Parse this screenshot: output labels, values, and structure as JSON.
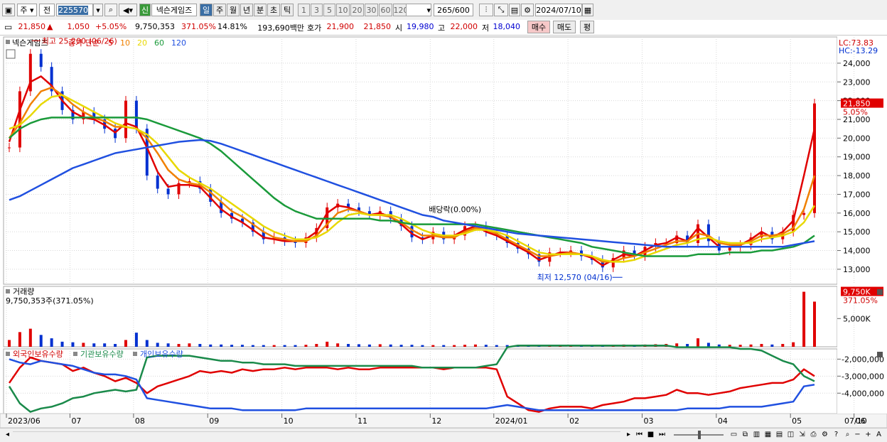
{
  "toolbar": {
    "market_type": "주",
    "market_scope": "전",
    "code": "225570",
    "new_badge": "신",
    "stock_name": "넥슨게임즈",
    "periods": [
      "일",
      "주",
      "월",
      "년",
      "분",
      "초",
      "틱"
    ],
    "active_period": "일",
    "intervals": [
      "1",
      "3",
      "5",
      "10",
      "20",
      "30",
      "60",
      "120"
    ],
    "count_display": "265/600",
    "date": "2024/07/10"
  },
  "quote": {
    "price": "21,850",
    "arrow": "▲",
    "change": "1,050",
    "change_pct": "+5.05%",
    "volume": "9,750,353",
    "volume_pct": "371.05%",
    "turnover": "14.81%",
    "amount": "193,690백만",
    "bid_label": "호가",
    "bid1": "21,900",
    "bid2": "21,850",
    "open_label": "시",
    "open": "19,980",
    "high_label": "고",
    "high": "22,000",
    "low_label": "저",
    "low": "18,040",
    "buy_button": "매수",
    "sell_button": "매도",
    "extra_button": "평"
  },
  "chart_data": [
    {
      "type": "line",
      "title": "넥슨게임즈",
      "legend": {
        "price": "종가 단순",
        "ma_labels": [
          "5",
          "10",
          "20",
          "60",
          "120"
        ],
        "ma_colors": [
          "#e00000",
          "#f08000",
          "#e8d800",
          "#1a9a3a",
          "#2050e0"
        ]
      },
      "yaxis": {
        "ticks": [
          "24,000",
          "23,000",
          "22,000",
          "21,000",
          "20,000",
          "19,000",
          "18,000",
          "17,000",
          "16,000",
          "15,000",
          "14,000",
          "13,000"
        ],
        "ylim": [
          12200,
          25400
        ]
      },
      "xaxis": {
        "ticks": [
          "2023/06",
          "07",
          "08",
          "09",
          "10",
          "11",
          "12",
          "2024/01",
          "02",
          "03",
          "04",
          "05",
          "06",
          "07",
          "07/10"
        ]
      },
      "lc_label": "LC:73.83",
      "hc_label": "HC:-13.29",
      "current_price_label": "21,850",
      "current_change_label": "5.05%",
      "annotations": {
        "high": "최고 25,200 (06/26)",
        "low": "최저 12,570 (04/16)",
        "dividend": "배당락(0.00%)"
      },
      "series": [
        {
          "name": "종가",
          "color": "#000000",
          "values": [
            19500,
            22500,
            24500,
            23800,
            22500,
            21500,
            21000,
            21400,
            21000,
            20500,
            20000,
            22000,
            20500,
            18000,
            17300,
            17000,
            17600,
            17700,
            17300,
            16600,
            16000,
            15700,
            15500,
            15000,
            14600,
            14700,
            14500,
            14400,
            14700,
            15200,
            16300,
            16500,
            16300,
            16100,
            15900,
            16100,
            15700,
            15300,
            14700,
            14600,
            15000,
            14600,
            14800,
            15300,
            15300,
            15000,
            14800,
            14400,
            14100,
            13800,
            13400,
            13900,
            13900,
            14000,
            13700,
            13500,
            13100,
            13600,
            14000,
            13700,
            14200,
            14400,
            14400,
            14800,
            14400,
            15400,
            14500,
            14000,
            14200,
            14300,
            14700,
            15000,
            14600,
            15000,
            15900,
            16000,
            21850
          ]
        },
        {
          "name": "5",
          "color": "#e00000",
          "values": [
            19800,
            21500,
            23000,
            23300,
            22800,
            22000,
            21400,
            21100,
            21000,
            20700,
            20300,
            20800,
            20600,
            19500,
            18200,
            17400,
            17500,
            17500,
            17400,
            16800,
            16200,
            15800,
            15500,
            15100,
            14700,
            14600,
            14500,
            14500,
            14600,
            15000,
            16000,
            16400,
            16300,
            16100,
            15900,
            16000,
            15800,
            15400,
            14900,
            14600,
            14800,
            14700,
            14800,
            15100,
            15300,
            15000,
            14800,
            14500,
            14200,
            13900,
            13500,
            13700,
            13900,
            13900,
            13800,
            13600,
            13200,
            13500,
            13800,
            13700,
            14000,
            14300,
            14400,
            14700,
            14500,
            15200,
            14700,
            14200,
            14200,
            14300,
            14600,
            15000,
            14700,
            15000,
            15600,
            18000,
            20500
          ]
        },
        {
          "name": "10",
          "color": "#f08000",
          "values": [
            20000,
            20800,
            21800,
            22500,
            22700,
            22300,
            21800,
            21400,
            21100,
            20900,
            20600,
            20600,
            20500,
            20000,
            19200,
            18300,
            17800,
            17600,
            17500,
            17100,
            16600,
            16100,
            15800,
            15400,
            15000,
            14700,
            14600,
            14500,
            14500,
            14800,
            15400,
            16000,
            16200,
            16100,
            15900,
            15900,
            15800,
            15500,
            15100,
            14800,
            14800,
            14700,
            14700,
            15000,
            15200,
            15100,
            14900,
            14600,
            14300,
            14000,
            13700,
            13700,
            13800,
            13900,
            13800,
            13700,
            13400,
            13400,
            13600,
            13700,
            13900,
            14100,
            14300,
            14500,
            14500,
            14900,
            14800,
            14400,
            14300,
            14300,
            14500,
            14800,
            14800,
            14900,
            15200,
            16200,
            18000
          ]
        },
        {
          "name": "20",
          "color": "#e8d800",
          "values": [
            20500,
            20700,
            21200,
            21800,
            22200,
            22300,
            22000,
            21700,
            21400,
            21100,
            20800,
            20600,
            20500,
            20200,
            19700,
            19000,
            18300,
            17900,
            17600,
            17300,
            16900,
            16500,
            16100,
            15700,
            15300,
            15000,
            14800,
            14600,
            14600,
            14700,
            15000,
            15500,
            15900,
            16000,
            15900,
            15900,
            15900,
            15700,
            15400,
            15100,
            14900,
            14800,
            14800,
            14900,
            15100,
            15100,
            15000,
            14800,
            14500,
            14200,
            13900,
            13800,
            13800,
            13800,
            13800,
            13700,
            13500,
            13400,
            13400,
            13500,
            13700,
            13900,
            14100,
            14300,
            14400,
            14600,
            14700,
            14500,
            14400,
            14400,
            14400,
            14600,
            14700,
            14800,
            15000,
            15500,
            16400
          ]
        },
        {
          "name": "60",
          "color": "#1a9a3a",
          "values": [
            20000,
            20500,
            20800,
            21000,
            21100,
            21100,
            21100,
            21100,
            21100,
            21100,
            21100,
            21100,
            21100,
            21000,
            20800,
            20600,
            20400,
            20200,
            20000,
            19700,
            19300,
            18800,
            18300,
            17800,
            17300,
            16800,
            16400,
            16100,
            15900,
            15700,
            15700,
            15700,
            15700,
            15700,
            15700,
            15600,
            15600,
            15500,
            15400,
            15400,
            15400,
            15400,
            15400,
            15400,
            15400,
            15300,
            15200,
            15100,
            15000,
            14900,
            14800,
            14700,
            14600,
            14500,
            14400,
            14200,
            14100,
            14000,
            13900,
            13800,
            13700,
            13700,
            13700,
            13700,
            13700,
            13800,
            13800,
            13800,
            13900,
            13900,
            13900,
            14000,
            14000,
            14100,
            14200,
            14400,
            14800
          ]
        },
        {
          "name": "120",
          "color": "#2050e0",
          "values": [
            16700,
            16900,
            17200,
            17500,
            17800,
            18100,
            18400,
            18600,
            18800,
            19000,
            19200,
            19300,
            19400,
            19500,
            19600,
            19700,
            19800,
            19850,
            19900,
            19850,
            19700,
            19500,
            19300,
            19100,
            18900,
            18700,
            18500,
            18300,
            18100,
            17900,
            17700,
            17500,
            17300,
            17100,
            16900,
            16700,
            16500,
            16300,
            16100,
            15900,
            15800,
            15600,
            15500,
            15400,
            15300,
            15200,
            15100,
            15000,
            14900,
            14850,
            14800,
            14750,
            14700,
            14650,
            14600,
            14550,
            14500,
            14450,
            14400,
            14350,
            14300,
            14250,
            14200,
            14200,
            14200,
            14200,
            14200,
            14200,
            14200,
            14200,
            14200,
            14200,
            14200,
            14200,
            14300,
            14400,
            14500
          ]
        }
      ]
    },
    {
      "type": "bar",
      "title": "거래량",
      "value_label": "9,750,353주(371.05%)",
      "ytick": "5,000K",
      "current_label": "9,750K",
      "current_pct_label": "371.05%",
      "values": [
        1200,
        2600,
        3200,
        2100,
        1500,
        900,
        800,
        700,
        600,
        600,
        500,
        1200,
        2500,
        1200,
        700,
        600,
        500,
        600,
        500,
        400,
        400,
        350,
        350,
        300,
        300,
        300,
        300,
        300,
        350,
        500,
        900,
        600,
        500,
        450,
        400,
        450,
        400,
        350,
        350,
        300,
        300,
        300,
        300,
        350,
        400,
        350,
        300,
        300,
        300,
        300,
        300,
        300,
        300,
        300,
        300,
        300,
        280,
        300,
        400,
        350,
        400,
        450,
        500,
        600,
        500,
        1500,
        700,
        400,
        350,
        350,
        400,
        500,
        400,
        500,
        800,
        9750,
        8000
      ]
    },
    {
      "type": "line",
      "title": "외국인보유수량",
      "legend_items": [
        "외국인보유수량",
        "기관보유수량",
        "개인보유수량"
      ],
      "yaxis": {
        "ticks": [
          "-2,000,000",
          "-3,000,000",
          "-4,000,000"
        ],
        "ylim": [
          -5200000,
          -1400000
        ]
      },
      "series": [
        {
          "name": "외국인보유수량",
          "color": "#e00000",
          "values": [
            -3400000,
            -2500000,
            -1900000,
            -2100000,
            -2200000,
            -2300000,
            -2700000,
            -2500000,
            -2800000,
            -3000000,
            -3300000,
            -3100000,
            -3400000,
            -4000000,
            -3600000,
            -3400000,
            -3200000,
            -3000000,
            -2700000,
            -2800000,
            -2700000,
            -2800000,
            -2600000,
            -2700000,
            -2600000,
            -2600000,
            -2500000,
            -2600000,
            -2500000,
            -2500000,
            -2500000,
            -2600000,
            -2500000,
            -2600000,
            -2600000,
            -2500000,
            -2500000,
            -2500000,
            -2500000,
            -2500000,
            -2500000,
            -2600000,
            -2500000,
            -2500000,
            -2500000,
            -2500000,
            -2600000,
            -4200000,
            -4600000,
            -5000000,
            -5100000,
            -4900000,
            -4800000,
            -4800000,
            -4800000,
            -4900000,
            -4700000,
            -4600000,
            -4500000,
            -4300000,
            -4300000,
            -4200000,
            -4100000,
            -3800000,
            -4000000,
            -4000000,
            -4100000,
            -4000000,
            -3900000,
            -3700000,
            -3600000,
            -3500000,
            -3400000,
            -3400000,
            -3200000,
            -2600000,
            -3000000
          ]
        },
        {
          "name": "기관보유수량",
          "color": "#1a8a4a",
          "values": [
            -3600000,
            -4600000,
            -5100000,
            -4900000,
            -4800000,
            -4600000,
            -4300000,
            -4200000,
            -4000000,
            -3900000,
            -3800000,
            -3900000,
            -3800000,
            -1900000,
            -1800000,
            -1800000,
            -1800000,
            -1800000,
            -1900000,
            -2000000,
            -2100000,
            -2100000,
            -2200000,
            -2200000,
            -2300000,
            -2300000,
            -2300000,
            -2400000,
            -2400000,
            -2400000,
            -2400000,
            -2400000,
            -2400000,
            -2400000,
            -2400000,
            -2400000,
            -2400000,
            -2400000,
            -2400000,
            -2500000,
            -2500000,
            -2500000,
            -2500000,
            -2500000,
            -2500000,
            -2400000,
            -2300000,
            -1300000,
            -1200000,
            -1200000,
            -1200000,
            -1200000,
            -1200000,
            -1200000,
            -1200000,
            -1200000,
            -1200000,
            -1200000,
            -1200000,
            -1200000,
            -1200000,
            -1200000,
            -1200000,
            -1300000,
            -1300000,
            -1300000,
            -1300000,
            -1300000,
            -1300000,
            -1400000,
            -1400000,
            -1500000,
            -1800000,
            -2100000,
            -2300000,
            -3000000,
            -3300000
          ]
        },
        {
          "name": "개인보유수량",
          "color": "#2050e0",
          "values": [
            -2000000,
            -2200000,
            -2300000,
            -2100000,
            -2200000,
            -2300000,
            -2400000,
            -2600000,
            -2800000,
            -2900000,
            -2900000,
            -3000000,
            -3200000,
            -4300000,
            -4400000,
            -4500000,
            -4600000,
            -4700000,
            -4800000,
            -4900000,
            -4900000,
            -4900000,
            -5000000,
            -5000000,
            -5000000,
            -5000000,
            -5000000,
            -5000000,
            -4900000,
            -4900000,
            -4900000,
            -4900000,
            -4900000,
            -4900000,
            -4900000,
            -4900000,
            -4900000,
            -4900000,
            -4900000,
            -4900000,
            -4900000,
            -4900000,
            -4900000,
            -4900000,
            -4900000,
            -4900000,
            -4800000,
            -4700000,
            -4800000,
            -4900000,
            -5000000,
            -5000000,
            -5000000,
            -5000000,
            -5000000,
            -5000000,
            -5000000,
            -5000000,
            -5000000,
            -5000000,
            -5000000,
            -5000000,
            -5000000,
            -5000000,
            -4900000,
            -4900000,
            -4900000,
            -4900000,
            -4800000,
            -4800000,
            -4800000,
            -4800000,
            -4700000,
            -4600000,
            -4500000,
            -3600000,
            -3500000
          ]
        }
      ]
    }
  ]
}
